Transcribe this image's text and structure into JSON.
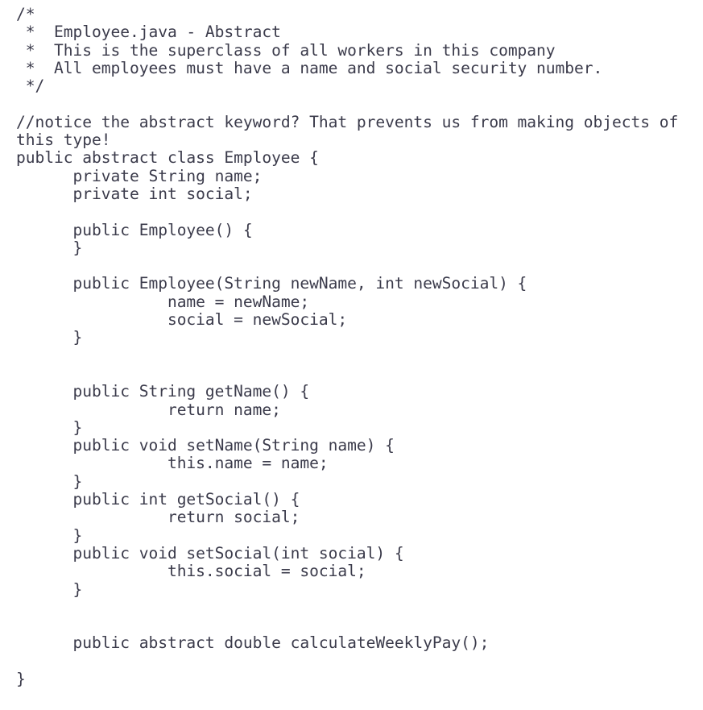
{
  "document": {
    "kind": "source-code-listing",
    "language": "Java",
    "file_name": "Employee.java",
    "background_color": "#ffffff",
    "text_color": "#3b3b4b"
  },
  "code": {
    "lines": [
      "/*",
      " *  Employee.java - Abstract",
      " *  This is the superclass of all workers in this company",
      " *  All employees must have a name and social security number.",
      " */",
      "",
      "//notice the abstract keyword? That prevents us from making objects of",
      "this type!",
      "public abstract class Employee {",
      "      private String name;",
      "      private int social;",
      "",
      "      public Employee() {",
      "      }",
      "",
      "      public Employee(String newName, int newSocial) {",
      "                name = newName;",
      "                social = newSocial;",
      "      }",
      "",
      "",
      "      public String getName() {",
      "                return name;",
      "      }",
      "      public void setName(String name) {",
      "                this.name = name;",
      "      }",
      "      public int getSocial() {",
      "                return social;",
      "      }",
      "      public void setSocial(int social) {",
      "                this.social = social;",
      "      }",
      "",
      "",
      "      public abstract double calculateWeeklyPay();",
      "",
      "}"
    ]
  }
}
